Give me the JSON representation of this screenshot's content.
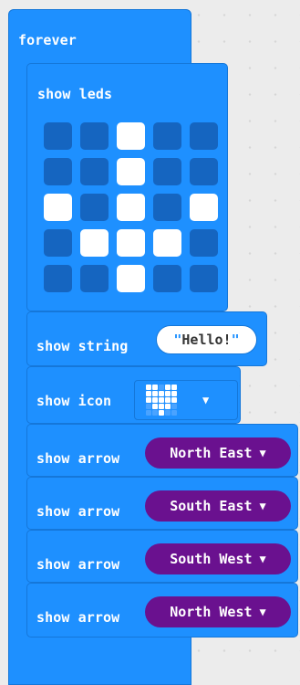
{
  "forever": {
    "label": "forever"
  },
  "show_leds": {
    "label": "show leds",
    "grid": [
      [
        0,
        0,
        1,
        0,
        0
      ],
      [
        0,
        0,
        1,
        0,
        0
      ],
      [
        1,
        0,
        1,
        0,
        1
      ],
      [
        0,
        1,
        1,
        1,
        0
      ],
      [
        0,
        0,
        1,
        0,
        0
      ]
    ]
  },
  "show_string": {
    "label": "show string",
    "quote_open": "\"",
    "value": "Hello!",
    "quote_close": "\""
  },
  "show_icon": {
    "label": "show icon",
    "icon": "heart-icon",
    "grid": [
      [
        1,
        1,
        0,
        1,
        1
      ],
      [
        1,
        1,
        1,
        1,
        1
      ],
      [
        1,
        1,
        1,
        1,
        1
      ],
      [
        0,
        1,
        1,
        1,
        0
      ],
      [
        0,
        0,
        1,
        0,
        0
      ]
    ],
    "caret": "▼"
  },
  "arrows": [
    {
      "label": "show arrow",
      "direction": "North East",
      "caret": "▼"
    },
    {
      "label": "show arrow",
      "direction": "South East",
      "caret": "▼"
    },
    {
      "label": "show arrow",
      "direction": "South West",
      "caret": "▼"
    },
    {
      "label": "show arrow",
      "direction": "North West",
      "caret": "▼"
    }
  ],
  "colors": {
    "basic_block": "#1e90ff",
    "led_off": "#1565c0",
    "led_on": "#ffffff",
    "arrow_dropdown": "#6a118f",
    "workspace": "#ececec"
  }
}
